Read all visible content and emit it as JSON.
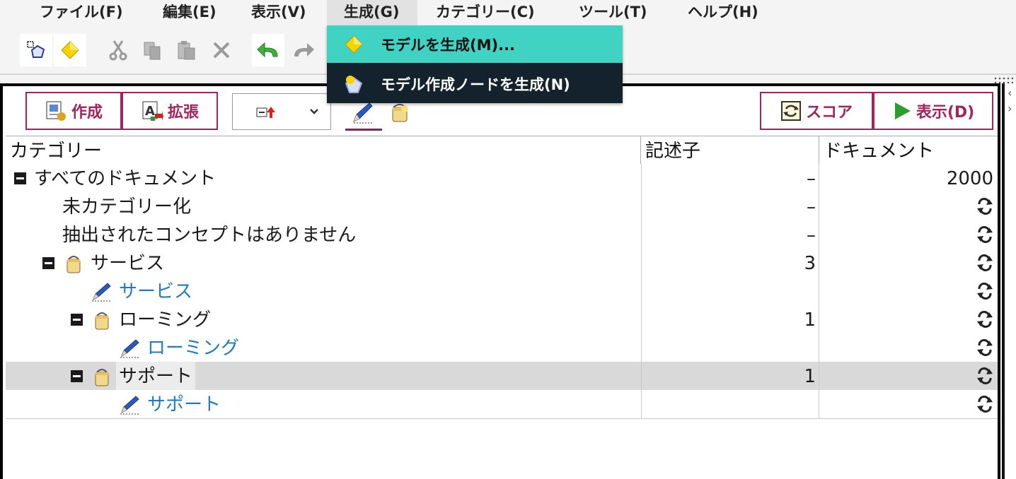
{
  "menubar": {
    "items": [
      {
        "label": "ファイル(F)"
      },
      {
        "label": "編集(E)"
      },
      {
        "label": "表示(V)"
      },
      {
        "label": "生成(G)"
      },
      {
        "label": "カテゴリー(C)"
      },
      {
        "label": "ツール(T)"
      },
      {
        "label": "ヘルプ(H)"
      }
    ]
  },
  "dropdown": {
    "items": [
      {
        "label": "モデルを生成(M)...",
        "icon": "diamond-icon"
      },
      {
        "label": "モデル作成ノードを生成(N)",
        "icon": "model-node-icon"
      }
    ]
  },
  "panel_toolbar": {
    "create_label": "作成",
    "extend_label": "拡張",
    "score_label": "スコア",
    "display_label": "表示(D)"
  },
  "table": {
    "columns": [
      "カテゴリー",
      "記述子",
      "ドキュメント"
    ],
    "rows": [
      {
        "name": "すべてのドキュメント",
        "descriptors": "–",
        "documents": "2000"
      },
      {
        "name": "未カテゴリー化",
        "descriptors": "–",
        "documents": ""
      },
      {
        "name": "抽出されたコンセプトはありません",
        "descriptors": "–",
        "documents": ""
      },
      {
        "name": "サービス",
        "descriptors": "3",
        "documents": ""
      },
      {
        "name": "サービス",
        "descriptors": "",
        "documents": ""
      },
      {
        "name": "ローミング",
        "descriptors": "1",
        "documents": ""
      },
      {
        "name": "ローミング",
        "descriptors": "",
        "documents": ""
      },
      {
        "name": "サポート",
        "descriptors": "1",
        "documents": ""
      },
      {
        "name": "サポート",
        "descriptors": "",
        "documents": ""
      }
    ]
  },
  "colors": {
    "accent": "#a3245d",
    "highlight": "#40d2c2",
    "menu_dark": "#14222e",
    "link_blue": "#1c7ac7",
    "selected_row": "#d9d9d9"
  }
}
